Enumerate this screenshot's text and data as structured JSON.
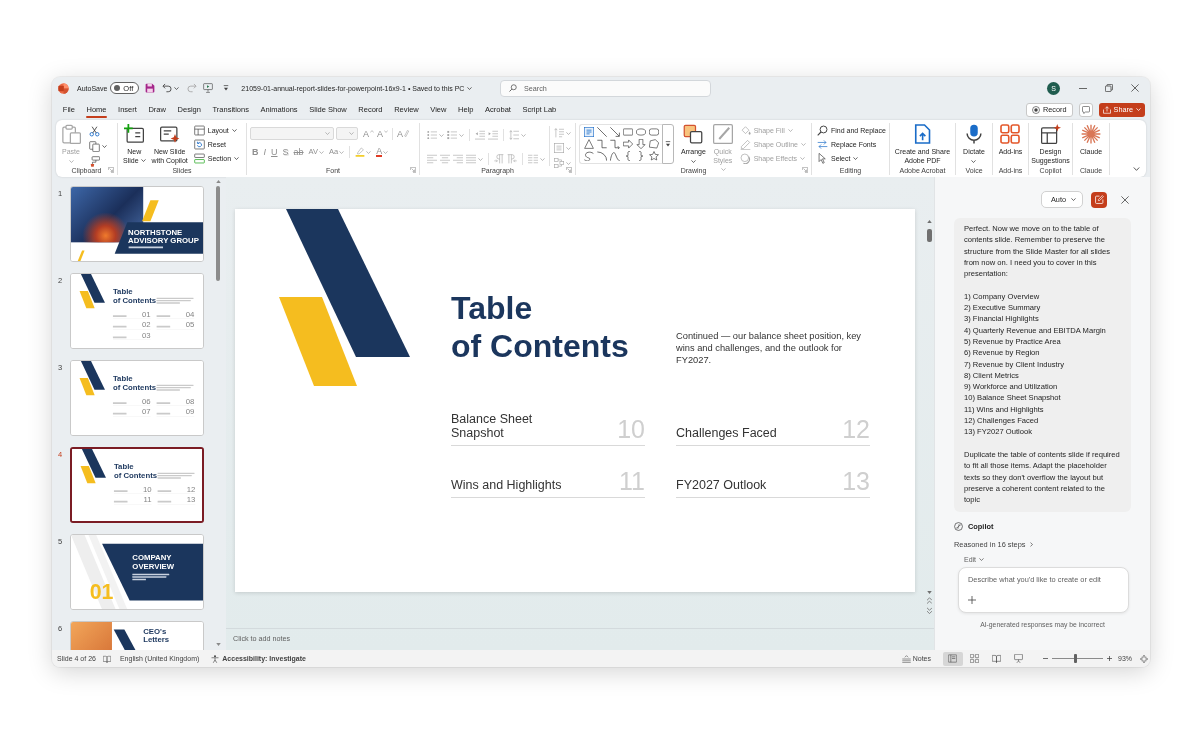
{
  "title_bar": {
    "autosave": {
      "label": "AutoSave",
      "state": "Off",
      "on": false
    },
    "document": "21059-01-annual-report-slides-for-powerpoint-16x9-1 • Saved to this PC",
    "search": {
      "placeholder": "Search"
    },
    "account": "S"
  },
  "ribbon_tabs": [
    {
      "label": "File",
      "selected": false
    },
    {
      "label": "Home",
      "selected": true
    },
    {
      "label": "Insert",
      "selected": false
    },
    {
      "label": "Draw",
      "selected": false
    },
    {
      "label": "Design",
      "selected": false
    },
    {
      "label": "Transitions",
      "selected": false
    },
    {
      "label": "Animations",
      "selected": false
    },
    {
      "label": "Slide Show",
      "selected": false
    },
    {
      "label": "Record",
      "selected": false
    },
    {
      "label": "Review",
      "selected": false
    },
    {
      "label": "View",
      "selected": false
    },
    {
      "label": "Help",
      "selected": false
    },
    {
      "label": "Acrobat",
      "selected": false
    },
    {
      "label": "Script Lab",
      "selected": false
    }
  ],
  "header_buttons": {
    "record": "Record",
    "share": "Share"
  },
  "ribbon": {
    "groups": [
      {
        "kind": "clipboard",
        "label": "Clipboard",
        "launcher": true,
        "buttons": [
          {
            "kind": "large",
            "label": "Paste",
            "dropdown": true,
            "disabled": true
          }
        ]
      },
      {
        "kind": "slides",
        "label": "Slides",
        "buttons": [
          {
            "kind": "large",
            "label": "New\nSlide",
            "dropdown": true,
            "disabled": false
          },
          {
            "kind": "large",
            "label": "New Slide\nwith Copilot",
            "dropdown": false,
            "disabled": false
          },
          {
            "kind": "small",
            "label": "Layout",
            "dropdown": true,
            "disabled": false
          },
          {
            "kind": "small",
            "label": "Reset",
            "dropdown": false,
            "disabled": false
          },
          {
            "kind": "small",
            "label": "Section",
            "dropdown": true,
            "disabled": false
          }
        ]
      },
      {
        "kind": "font",
        "label": "Font",
        "launcher": true,
        "tools": [
          {
            "kind": "grow",
            "text": "A",
            "dropdown": false
          },
          {
            "kind": "shrink",
            "text": "A",
            "dropdown": false
          },
          {
            "kind": "clear",
            "text": "A",
            "dropdown": false
          },
          {
            "kind": "bold",
            "text": "B",
            "dropdown": false
          },
          {
            "kind": "italic",
            "text": "I",
            "dropdown": false
          },
          {
            "kind": "underline",
            "text": "U",
            "dropdown": false
          },
          {
            "kind": "shadow",
            "text": "S",
            "dropdown": false
          },
          {
            "kind": "strike",
            "text": "ab",
            "dropdown": false
          },
          {
            "kind": "spacing",
            "text": "AV",
            "dropdown": true
          },
          {
            "kind": "case",
            "text": "Aa",
            "dropdown": true
          },
          {
            "kind": "highlight",
            "dropdown": true
          },
          {
            "kind": "color",
            "text": "A",
            "dropdown": true
          }
        ]
      },
      {
        "kind": "paragraph",
        "label": "Paragraph",
        "launcher": true
      },
      {
        "kind": "drawing",
        "label": "Drawing",
        "launcher": true,
        "buttons": [
          {
            "kind": "large",
            "label": "Arrange",
            "dropdown": true,
            "disabled": false
          },
          {
            "kind": "large",
            "label": "Quick\nStyles",
            "dropdown": true,
            "disabled": true
          },
          {
            "kind": "small",
            "label": "Shape Fill",
            "dropdown": true,
            "disabled": true
          },
          {
            "kind": "small",
            "label": "Shape Outline",
            "dropdown": true,
            "disabled": true
          },
          {
            "kind": "small",
            "label": "Shape Effects",
            "dropdown": true,
            "disabled": true
          }
        ]
      },
      {
        "kind": "editing",
        "label": "Editing",
        "buttons": [
          {
            "kind": "small",
            "label": "Find and Replace",
            "dropdown": false,
            "disabled": false
          },
          {
            "kind": "small",
            "label": "Replace Fonts",
            "dropdown": false,
            "disabled": false
          },
          {
            "kind": "small",
            "label": "Select",
            "dropdown": true,
            "disabled": false
          }
        ]
      },
      {
        "kind": "acrobat",
        "label": "Adobe Acrobat",
        "buttons": [
          {
            "kind": "large",
            "label": "Create and Share\nAdobe PDF",
            "dropdown": false,
            "disabled": false
          }
        ]
      },
      {
        "kind": "voice",
        "label": "Voice",
        "buttons": [
          {
            "kind": "large",
            "label": "Dictate",
            "dropdown": true,
            "disabled": false
          }
        ]
      },
      {
        "kind": "addins",
        "label": "Add-ins",
        "buttons": [
          {
            "kind": "large",
            "label": "Add-ins",
            "dropdown": false,
            "disabled": false
          }
        ]
      },
      {
        "kind": "copilot",
        "label": "Copilot",
        "buttons": [
          {
            "kind": "large",
            "label": "Design\nSuggestions",
            "dropdown": false,
            "disabled": false
          }
        ]
      },
      {
        "kind": "claude",
        "label": "Claude",
        "buttons": [
          {
            "kind": "large",
            "label": "Claude",
            "dropdown": false,
            "disabled": false
          }
        ]
      }
    ]
  },
  "slides_panel": {
    "thumbnails": [
      {
        "number": "1",
        "kind": "cover",
        "selected": false,
        "title": "NORTHSTONE ADVISORY GROUP"
      },
      {
        "number": "2",
        "kind": "contents",
        "selected": false,
        "title": "Table\nof Contents",
        "numbers": [
          "01",
          "02",
          "03",
          "04",
          "05"
        ]
      },
      {
        "number": "3",
        "kind": "contents",
        "selected": false,
        "title": "Table\nof Contents",
        "numbers": [
          "06",
          "07",
          "08",
          "09"
        ]
      },
      {
        "number": "4",
        "kind": "contents",
        "selected": true,
        "title": "Table\nof Contents",
        "numbers": [
          "10",
          "11",
          "12",
          "13"
        ]
      },
      {
        "number": "5",
        "kind": "section",
        "selected": false,
        "title": "COMPANY OVERVIEW",
        "section_number": "01"
      },
      {
        "number": "6",
        "kind": "letter",
        "selected": false,
        "title": "CEO's Letters"
      }
    ]
  },
  "slide": {
    "title": "Table\nof Contents",
    "description": "Continued — our balance sheet position, key wins and challenges, and the outlook for FY2027.",
    "items": [
      {
        "label": "Balance Sheet\nSnapshot",
        "number": "10"
      },
      {
        "label": "Wins and Highlights",
        "number": "11"
      },
      {
        "label": "Challenges Faced",
        "number": "12"
      },
      {
        "label": "FY2027 Outlook",
        "number": "13"
      }
    ]
  },
  "notes": {
    "placeholder": "Click to add notes"
  },
  "copilot": {
    "mode": "Auto",
    "message": {
      "intro": "Perfect. Now we move on to the table of contents slide. Remember to preserve the structure from the Slide Master for all slides from now on. I need you to cover in this presentation:",
      "list": [
        "1) Company Overview",
        "2) Executive Summary",
        "3) Financial Highlights",
        "4) Quarterly Revenue and EBITDA Margin",
        "5) Revenue by Practice Area",
        "6) Revenue by Region",
        "7) Revenue by Client Industry",
        "8) Client Metrics",
        "9) Workforce and Utilization",
        "10) Balance Sheet Snapshot",
        "11) Wins and Highlights",
        "12) Challenges Faced",
        "13) FY2027 Outlook"
      ],
      "outro": "Duplicate the table of contents slide if required to fit all those items. Adapt the placeholder texts so they don't overflow the layout but preserve a coherent content related to the topic"
    },
    "sender": "Copilot",
    "reasoning": "Reasoned in 16 steps",
    "edit_mode": "Edit",
    "input": {
      "placeholder": "Describe what you'd like to create or edit"
    },
    "disclaimer": "AI-generated responses may be incorrect"
  },
  "status_bar": {
    "slide_position": "Slide 4 of 26",
    "language": "English (United Kingdom)",
    "accessibility": "Accessibility: Investigate",
    "notes": "Notes",
    "views": [
      {
        "selected": true
      },
      {
        "selected": false
      },
      {
        "selected": false
      },
      {
        "selected": false
      }
    ],
    "zoom": {
      "level": 0.47,
      "reading": "93%"
    }
  }
}
